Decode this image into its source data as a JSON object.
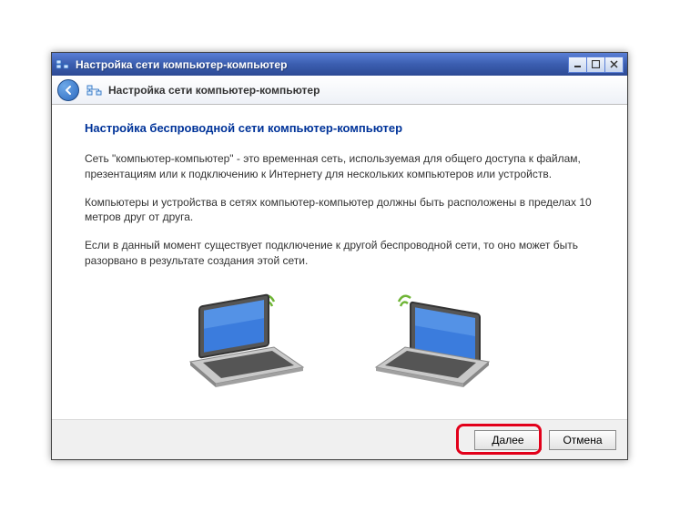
{
  "window": {
    "title": "Настройка сети компьютер-компьютер"
  },
  "header": {
    "title": "Настройка сети компьютер-компьютер"
  },
  "content": {
    "heading": "Настройка беспроводной сети компьютер-компьютер",
    "p1": "Сеть \"компьютер-компьютер\" - это временная сеть, используемая для общего доступа к файлам, презентациям или к подключению к Интернету для нескольких компьютеров или устройств.",
    "p2": "Компьютеры и устройства в сетях компьютер-компьютер должны быть расположены в пределах 10 метров друг от друга.",
    "p3": "Если в данный момент существует подключение к другой беспроводной сети, то оно может быть разорвано в результате создания этой сети."
  },
  "buttons": {
    "next": "Далее",
    "cancel": "Отмена"
  }
}
